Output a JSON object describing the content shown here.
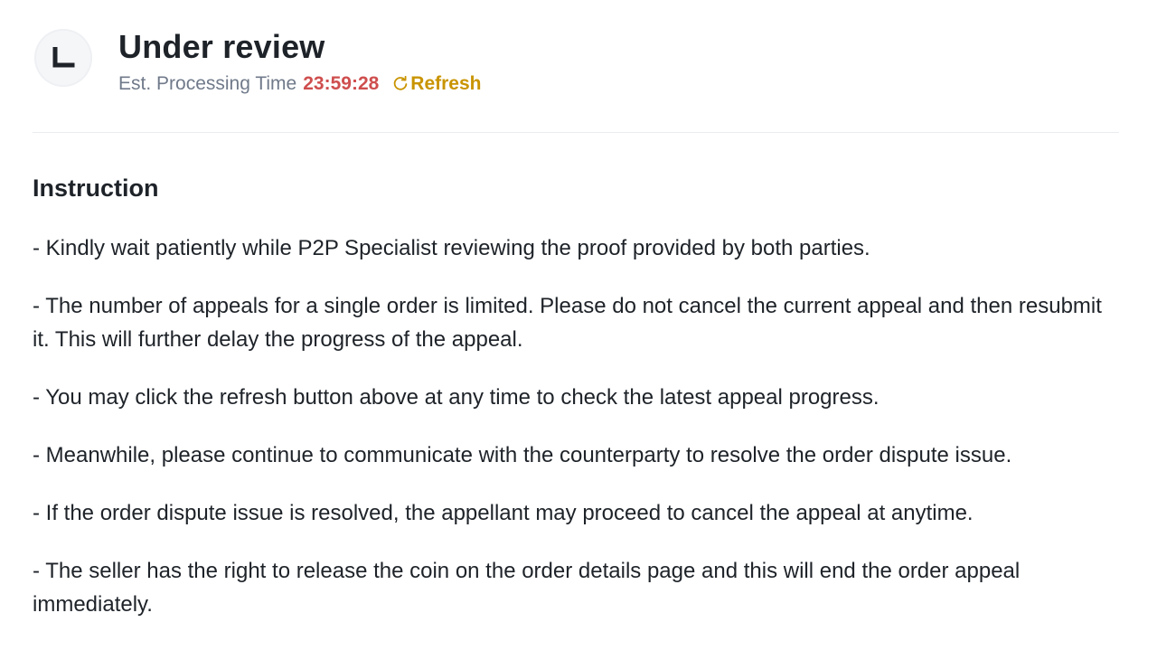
{
  "header": {
    "status_icon": "clock-icon",
    "title": "Under review",
    "processing_label": "Est. Processing Time",
    "countdown": "23:59:28",
    "refresh_icon": "refresh-icon",
    "refresh_label": "Refresh"
  },
  "instruction": {
    "title": "Instruction",
    "items": [
      "- Kindly wait patiently while P2P Specialist reviewing the proof provided by both parties.",
      "- The number of appeals for a single order is limited. Please do not cancel the current appeal and then resubmit it. This will further delay the progress of the appeal.",
      "- You may click the refresh button above at any time to check the latest appeal progress.",
      "- Meanwhile, please continue to communicate with the counterparty to resolve the order dispute issue.",
      "- If the order dispute issue is resolved, the appellant may proceed to cancel the appeal at anytime.",
      "- The seller has the right to release the coin on the order details page and this will end the order appeal immediately."
    ]
  },
  "colors": {
    "countdown": "#cf4e4e",
    "refresh": "#c99400",
    "text_primary": "#1e2329",
    "text_secondary": "#707a8a"
  }
}
